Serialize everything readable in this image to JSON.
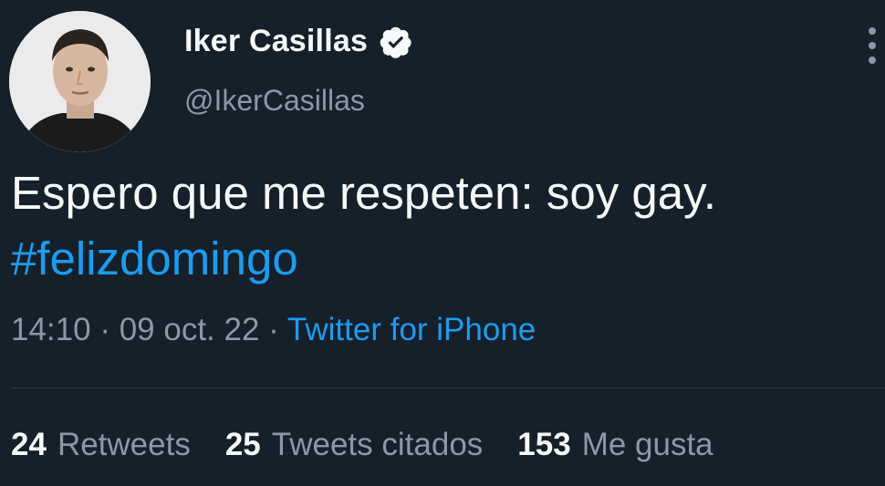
{
  "colors": {
    "background": "#15202b",
    "text": "#f7f9f9",
    "secondary": "#8b98a5",
    "link": "#1d9bf0"
  },
  "author": {
    "display_name": "Iker Casillas",
    "handle": "@IkerCasillas",
    "verified": true,
    "avatar_icon": "profile-photo"
  },
  "tweet": {
    "text": "Espero que me respeten: soy gay.",
    "hashtag": "#felizdomingo"
  },
  "meta": {
    "time": "14:10",
    "separator": " · ",
    "date": "09 oct. 22",
    "source": "Twitter for iPhone"
  },
  "stats": [
    {
      "count": "24",
      "label": "Retweets"
    },
    {
      "count": "25",
      "label": "Tweets citados"
    },
    {
      "count": "153",
      "label": "Me gusta"
    }
  ]
}
